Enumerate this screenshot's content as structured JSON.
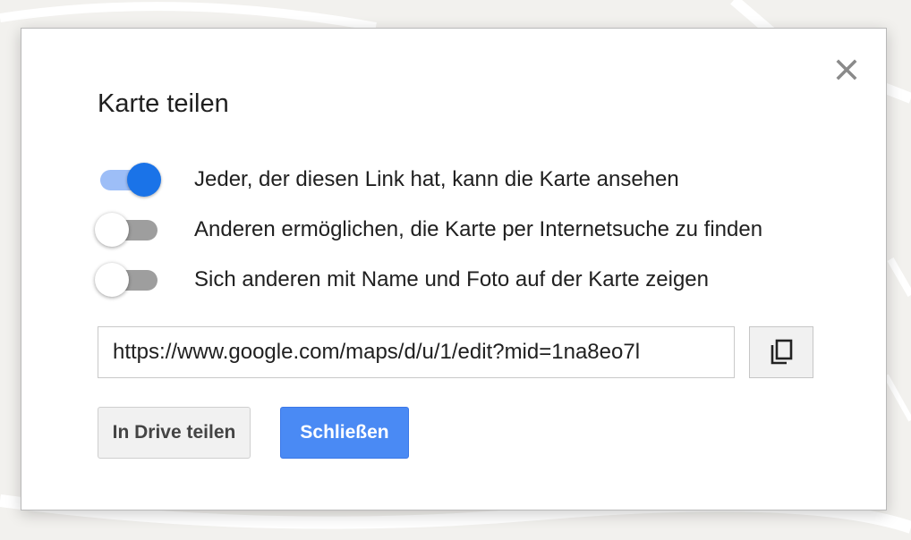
{
  "dialog": {
    "title": "Karte teilen",
    "options": [
      {
        "label": "Jeder, der diesen Link hat, kann die Karte ansehen",
        "enabled": true
      },
      {
        "label": "Anderen ermöglichen, die Karte per Internetsuche zu finden",
        "enabled": false
      },
      {
        "label": "Sich anderen mit Name und Foto auf der Karte zeigen",
        "enabled": false
      }
    ],
    "share_link": "https://www.google.com/maps/d/u/1/edit?mid=1na8eo7l",
    "drive_button_label": "In Drive teilen",
    "close_button_label": "Schließen",
    "icons": {
      "close": "close-icon",
      "copy": "copy-icon"
    },
    "colors": {
      "primary_blue": "#4a8af4",
      "toggle_on_knob": "#1a73e8",
      "toggle_on_track": "#9dbef7",
      "toggle_off_track": "#9e9e9e"
    }
  }
}
